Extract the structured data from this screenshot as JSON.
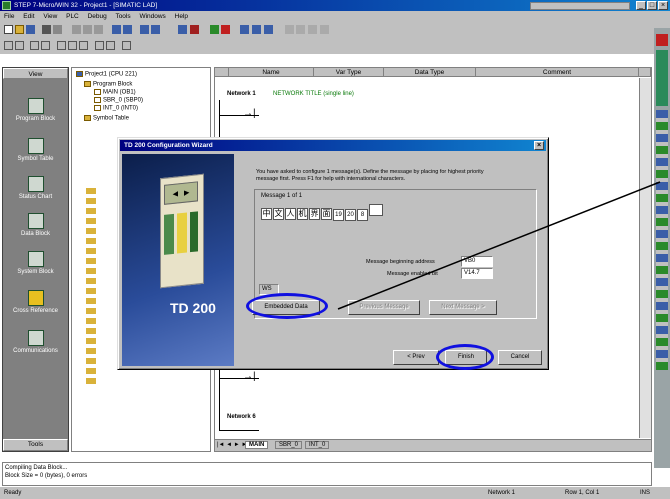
{
  "window": {
    "title": "STEP 7-Micro/WIN 32 - Project1 - [SIMATIC LAD]",
    "controls": [
      "_",
      "□",
      "×"
    ]
  },
  "menu": [
    "File",
    "Edit",
    "View",
    "PLC",
    "Debug",
    "Tools",
    "Windows",
    "Help"
  ],
  "viewbar": {
    "header": "View",
    "items": [
      "Program Block",
      "Symbol Table",
      "Status Chart",
      "Data Block",
      "System Block",
      "Cross Reference",
      "Communications"
    ],
    "footer": "Tools"
  },
  "tree": {
    "root": "Project1 (CPU 221)",
    "program_block": "Program Block",
    "nodes": [
      "MAIN (OB1)",
      "SBR_0 (SBP0)",
      "INT_0 (INT0)"
    ],
    "symbol_table": "Symbol Table"
  },
  "editor": {
    "columns": [
      "Name",
      "Var Type",
      "Data Type",
      "Comment"
    ],
    "network1_label": "Network 1",
    "network1_title": "NETWORK TITLE (single line)",
    "network6_label": "Network 6",
    "tabs": [
      "MAIN",
      "SBR_0",
      "INT_0"
    ]
  },
  "dialog": {
    "title": "TD 200 Configuration Wizard",
    "instructions": "You have asked to configure 1 message(s). Define the message by placing for highest priority message first. Press F1 for help with international characters.",
    "message_group": "Message 1 of 1",
    "chars": [
      "中",
      "文",
      "人",
      "机",
      "界",
      "面",
      "19",
      "20",
      "8",
      ""
    ],
    "address_label": "Message beginning address",
    "address_value": "VB0",
    "enabled_label": "Message enabled bit",
    "enabled_value": "V14.7",
    "small_field": "WS",
    "buttons": {
      "embedded": "Embedded Data",
      "prev_message": "Previous Message",
      "next_message": "Next Message >",
      "prev": "< Prev",
      "finish": "Finish",
      "cancel": "Cancel"
    },
    "device_label": "TD 200"
  },
  "output": {
    "line1": "Compiling Data Block...",
    "line2": "Block Size = 0 (bytes), 0 errors"
  },
  "status": {
    "left": "Ready",
    "network": "Network 1",
    "column": "Row 1, Col 1",
    "mode": "INS"
  },
  "colors": {
    "highlight": "#1010e0",
    "title_bar": "#000080"
  }
}
